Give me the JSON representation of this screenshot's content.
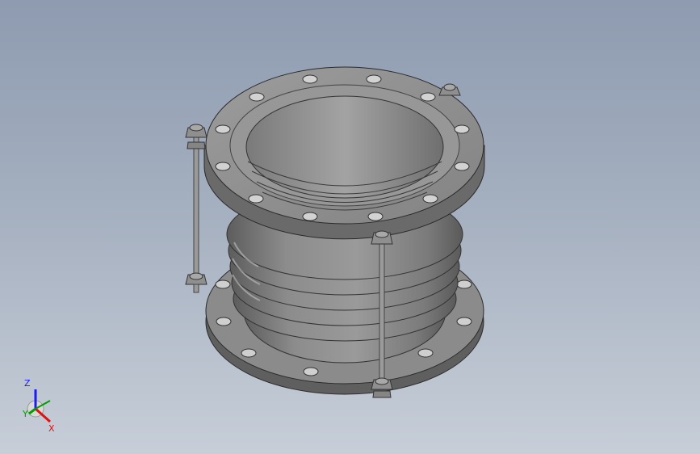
{
  "view": {
    "background_top": "#8e9bb0",
    "background_bottom": "#c7ced8",
    "model_color": "#8a8a8a"
  },
  "triad": {
    "z_label": "Z",
    "y_label": "Y",
    "x_label": "X",
    "z_color": "#1a1aff",
    "y_color": "#00a000",
    "x_color": "#e01010"
  }
}
